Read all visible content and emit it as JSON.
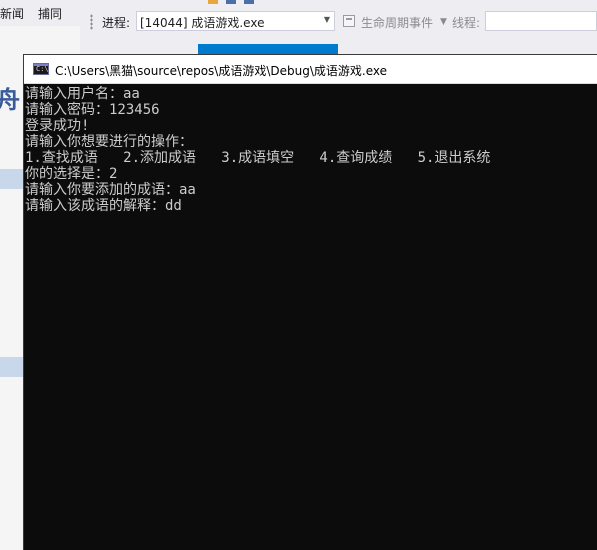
{
  "vs": {
    "menu": {
      "news": "新闻",
      "capture": "捕同"
    },
    "toolbar": {
      "process_label": "进程:",
      "process_value": "[14044] 成语游戏.exe",
      "lifecycle_label": "生命周期事件",
      "thread_label": "线程:"
    }
  },
  "console": {
    "title": "C:\\Users\\黑猫\\source\\repos\\成语游戏\\Debug\\成语游戏.exe",
    "icon_text": "C:\\",
    "lines": [
      "请输入用户名：aa",
      "请输入密码：123456",
      "登录成功!",
      "请输入你想要进行的操作：",
      "1.查找成语   2.添加成语   3.成语填空   4.查询成绩   5.退出系统",
      "你的选择是：2",
      "请输入你要添加的成语：aa",
      "请输入该成语的解释：dd"
    ]
  }
}
